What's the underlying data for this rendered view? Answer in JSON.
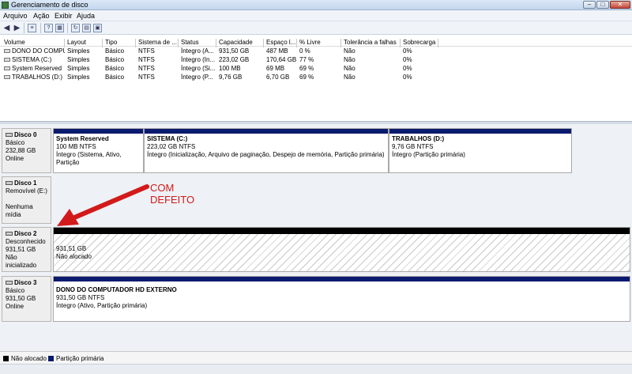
{
  "window": {
    "title": "Gerenciamento de disco"
  },
  "menu": [
    "Arquivo",
    "Ação",
    "Exibir",
    "Ajuda"
  ],
  "toolbar": {
    "icons": [
      "back-arrow-icon",
      "forward-arrow-icon",
      "list-view-icon",
      "help-icon",
      "properties-icon",
      "refresh-icon",
      "rescan-icon",
      "settings-icon"
    ]
  },
  "volume_list": {
    "columns": [
      "Volume",
      "Layout",
      "Tipo",
      "Sistema de ...",
      "Status",
      "Capacidade",
      "Espaço l...",
      "% Livre",
      "Tolerância a falhas",
      "Sobrecarga"
    ],
    "rows": [
      {
        "volume": "DONO DO COMPUTA...",
        "layout": "Simples",
        "tipo": "Básico",
        "sistema": "NTFS",
        "status": "Íntegro (A...",
        "capacidade": "931,50 GB",
        "espaco": "487 MB",
        "livre": "0 %",
        "tolerancia": "Não",
        "sobrecarga": "0%"
      },
      {
        "volume": "SISTEMA (C:)",
        "layout": "Simples",
        "tipo": "Básico",
        "sistema": "NTFS",
        "status": "Íntegro (In...",
        "capacidade": "223,02 GB",
        "espaco": "170,64 GB",
        "livre": "77 %",
        "tolerancia": "Não",
        "sobrecarga": "0%"
      },
      {
        "volume": "System Reserved",
        "layout": "Simples",
        "tipo": "Básico",
        "sistema": "NTFS",
        "status": "Íntegro (Si...",
        "capacidade": "100 MB",
        "espaco": "69 MB",
        "livre": "69 %",
        "tolerancia": "Não",
        "sobrecarga": "0%"
      },
      {
        "volume": "TRABALHOS (D:)",
        "layout": "Simples",
        "tipo": "Básico",
        "sistema": "NTFS",
        "status": "Íntegro (P...",
        "capacidade": "9,76 GB",
        "espaco": "6,70 GB",
        "livre": "69 %",
        "tolerancia": "Não",
        "sobrecarga": "0%"
      }
    ]
  },
  "disks": [
    {
      "name": "Disco 0",
      "type": "Básico",
      "size": "232,88 GB",
      "state": "Online",
      "partitions": [
        {
          "name": "System Reserved",
          "size": "100 MB NTFS",
          "status": "Íntegro (Sistema, Ativo, Partição"
        },
        {
          "name": "SISTEMA  (C:)",
          "size": "223,02 GB NTFS",
          "status": "Íntegro (Inicialização, Arquivo de paginação, Despejo de memória, Partição primária)"
        },
        {
          "name": "TRABALHOS  (D:)",
          "size": "9,76 GB NTFS",
          "status": "Íntegro (Partição primária)"
        }
      ]
    },
    {
      "name": "Disco 1",
      "type": "Removível (E:)",
      "size": "",
      "state": "Nenhuma mídia"
    },
    {
      "name": "Disco 2",
      "type": "Desconhecido",
      "size": "931,51 GB",
      "state": "Não inicializado",
      "partitions": [
        {
          "size": "931,51 GB",
          "status": "Não alocado"
        }
      ]
    },
    {
      "name": "Disco 3",
      "type": "Básico",
      "size": "931,50 GB",
      "state": "Online",
      "partitions": [
        {
          "name": "DONO DO COMPUTADOR HD EXTERNO",
          "size": "931,50 GB NTFS",
          "status": "Íntegro (Ativo, Partição primária)"
        }
      ]
    }
  ],
  "annotation": {
    "line1": "COM",
    "line2": "DEFEITO",
    "color": "#d21a1a"
  },
  "legend": [
    {
      "label": "Não alocado",
      "color": "#000000"
    },
    {
      "label": "Partição primária",
      "color": "#0a1a6e"
    }
  ]
}
